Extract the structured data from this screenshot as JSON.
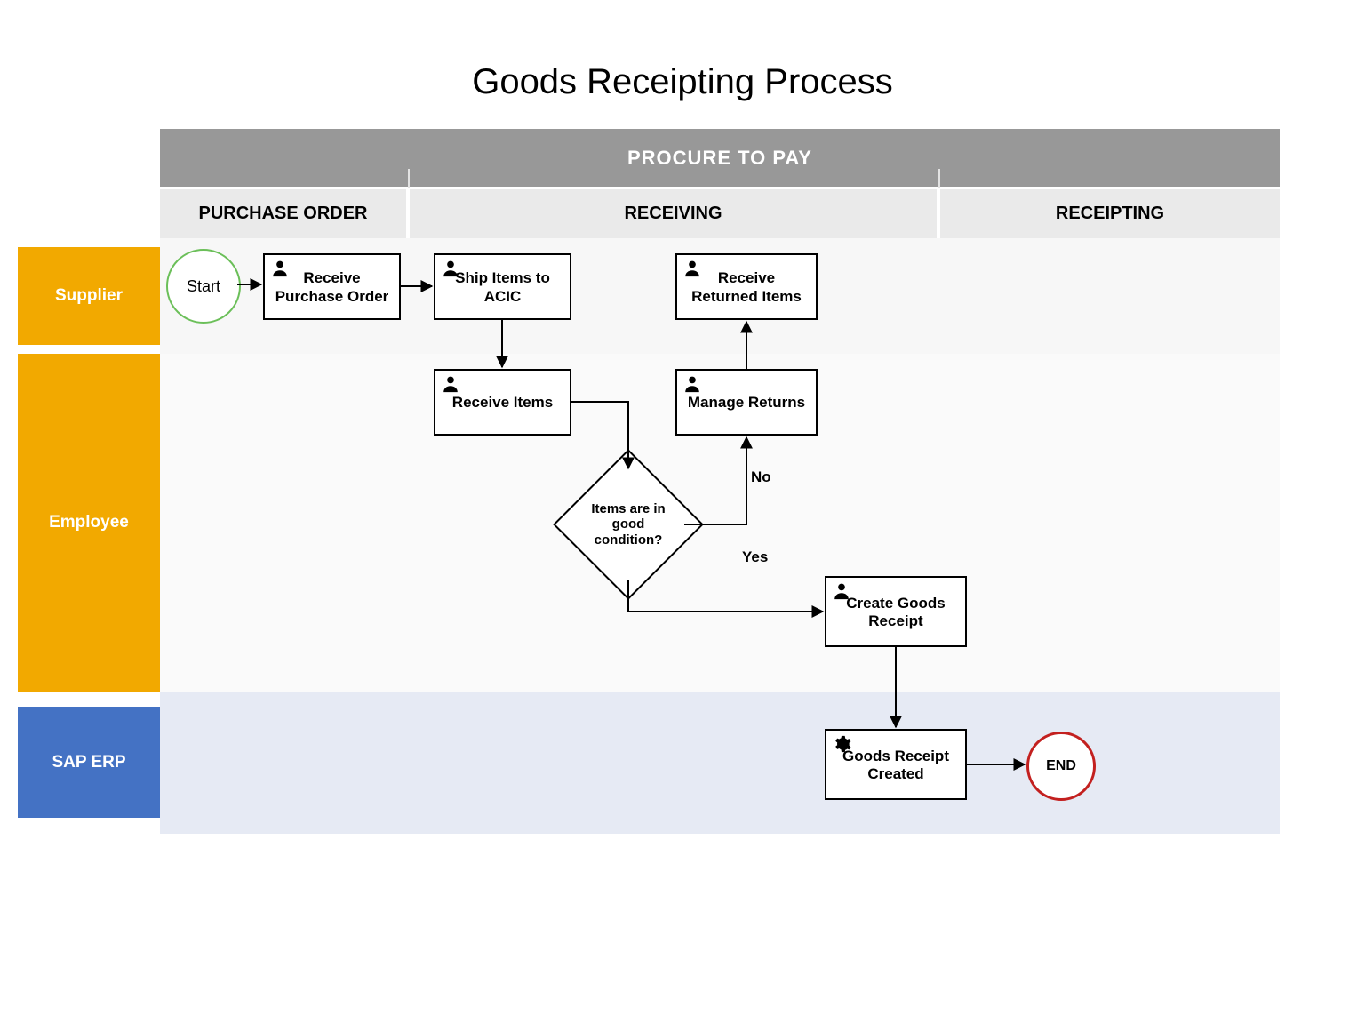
{
  "title": "Goods Receipting Process",
  "header": "PROCURE TO PAY",
  "columns": {
    "purchase_order": "PURCHASE ORDER",
    "receiving": "RECEIVING",
    "receipting": "RECEIPTING"
  },
  "lanes": {
    "supplier": "Supplier",
    "employee": "Employee",
    "sap": "SAP ERP"
  },
  "nodes": {
    "start": "Start",
    "receive_po": "Receive Purchase Order",
    "ship_items": "Ship Items to ACIC",
    "receive_returned": "Receive Returned Items",
    "receive_items": "Receive Items",
    "manage_returns": "Manage Returns",
    "decision": "Items are in good condition?",
    "create_gr": "Create Goods Receipt",
    "gr_created": "Goods Receipt Created",
    "end": "END"
  },
  "edges": {
    "yes": "Yes",
    "no": "No"
  }
}
